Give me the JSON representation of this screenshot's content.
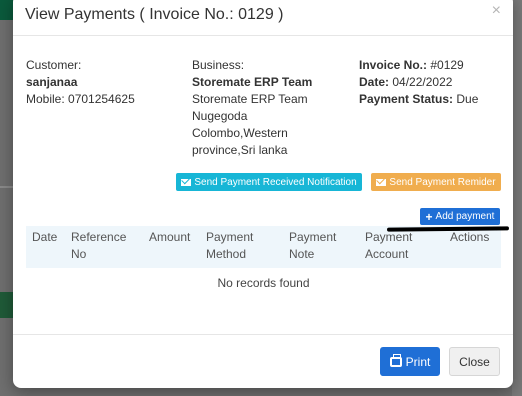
{
  "modal": {
    "title": "View Payments ( Invoice No.: 0129 )",
    "close_symbol": "×"
  },
  "customer": {
    "label": "Customer:",
    "name": "sanjanaa",
    "mobile": "Mobile: 0701254625"
  },
  "business": {
    "label": "Business:",
    "name": "Storemate ERP Team",
    "address_lines": [
      "Storemate ERP Team",
      "Nugegoda",
      "Colombo,Western",
      "province,Sri lanka"
    ]
  },
  "invoice": {
    "no_label": "Invoice No.:",
    "no_value": "#0129",
    "date_label": "Date:",
    "date_value": "04/22/2022",
    "status_label": "Payment Status:",
    "status_value": "Due"
  },
  "actions": {
    "notify_label": "Send Payment Received Notification",
    "remind_label": "Send Payment Remider",
    "add_label": "Add payment",
    "add_symbol": "+"
  },
  "table": {
    "headers": [
      [
        "Date"
      ],
      [
        "Reference",
        "No"
      ],
      [
        "Amount"
      ],
      [
        "Payment",
        "Method"
      ],
      [
        "Payment",
        "Note"
      ],
      [
        "Payment",
        "Account"
      ],
      [
        "Actions"
      ]
    ],
    "empty_message": "No records found"
  },
  "footer": {
    "print_label": "Print",
    "close_label": "Close"
  },
  "colors": {
    "primary": "#1f6fd6",
    "info": "#17b6d6",
    "warning": "#f0ad4e",
    "table_header_bg": "#eef6fb"
  }
}
